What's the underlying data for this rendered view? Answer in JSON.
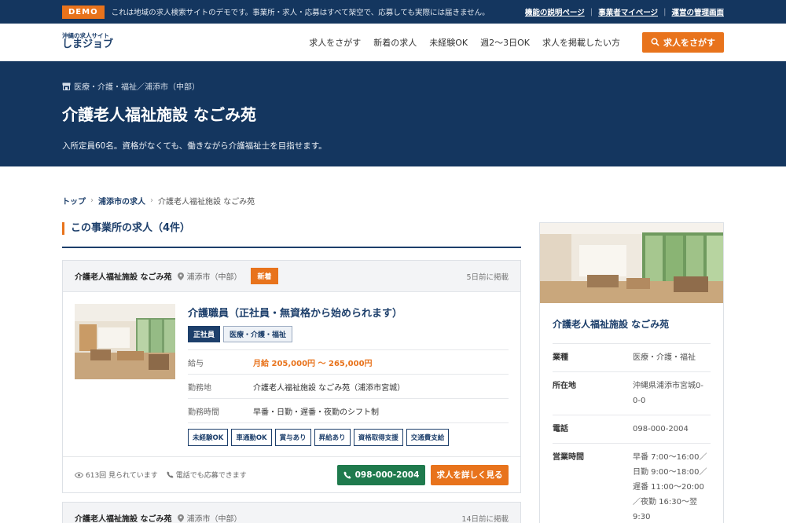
{
  "demo_bar": {
    "badge": "DEMO",
    "notice": "これは地域の求人検索サイトのデモです。事業所・求人・応募はすべて架空で、応募しても実際には届きません。",
    "links": [
      "機能の説明ページ",
      "事業者マイページ",
      "運営の管理画面"
    ]
  },
  "header": {
    "logo_sub": "沖縄の求人サイト",
    "logo_main": "しまジョブ",
    "nav": [
      "求人をさがす",
      "新着の求人",
      "未経験OK",
      "週2〜3日OK",
      "求人を掲載したい方"
    ],
    "search_button": "求人をさがす"
  },
  "hero": {
    "category": "医療・介護・福祉／浦添市（中部）",
    "title": "介護老人福祉施設 なごみ苑",
    "description": "入所定員60名。資格がなくても、働きながら介護福祉士を目指せます。"
  },
  "breadcrumb": [
    "トップ",
    "浦添市の求人",
    "介護老人福祉施設 なごみ苑"
  ],
  "section": {
    "title": "この事業所の求人（4件）"
  },
  "jobs": [
    {
      "company": "介護老人福祉施設 なごみ苑",
      "location": "浦添市（中部）",
      "badge": "新着",
      "posted": "5日前に掲載",
      "title": "介護職員（正社員・無資格から始められます）",
      "employment_tag": "正社員",
      "category_tag": "医療・介護・福祉",
      "salary_label": "給与",
      "salary": "月給 205,000円 〜 265,000円",
      "workplace_label": "勤務地",
      "workplace": "介護老人福祉施設 なごみ苑（浦添市宮城）",
      "hours_label": "勤務時間",
      "hours": "早番・日勤・遅番・夜勤のシフト制",
      "features": [
        "未経験OK",
        "車通勤OK",
        "賞与あり",
        "昇給あり",
        "資格取得支援",
        "交通費支給"
      ],
      "views": "613回 見られています",
      "phone_note": "電話でも応募できます",
      "tel_button": "098-000-2004",
      "detail_button": "求人を詳しく見る"
    },
    {
      "company": "介護老人福祉施設 なごみ苑",
      "location": "浦添市（中部）",
      "posted": "14日前に掲載"
    }
  ],
  "sidebar": {
    "title": "介護老人福祉施設 なごみ苑",
    "rows": [
      {
        "label": "業種",
        "value": "医療・介護・福祉"
      },
      {
        "label": "所在地",
        "value": "沖縄県浦添市宮城0-0-0"
      },
      {
        "label": "電話",
        "value": "098-000-2004"
      },
      {
        "label": "営業時間",
        "value": "早番 7:00〜16:00／日勤 9:00〜18:00／遅番 11:00〜20:00／夜勤 16:30〜翌9:30"
      }
    ]
  },
  "colors": {
    "navy": "#14365f",
    "accent_orange": "#e8731c",
    "tel_green": "#1f7a4d"
  }
}
